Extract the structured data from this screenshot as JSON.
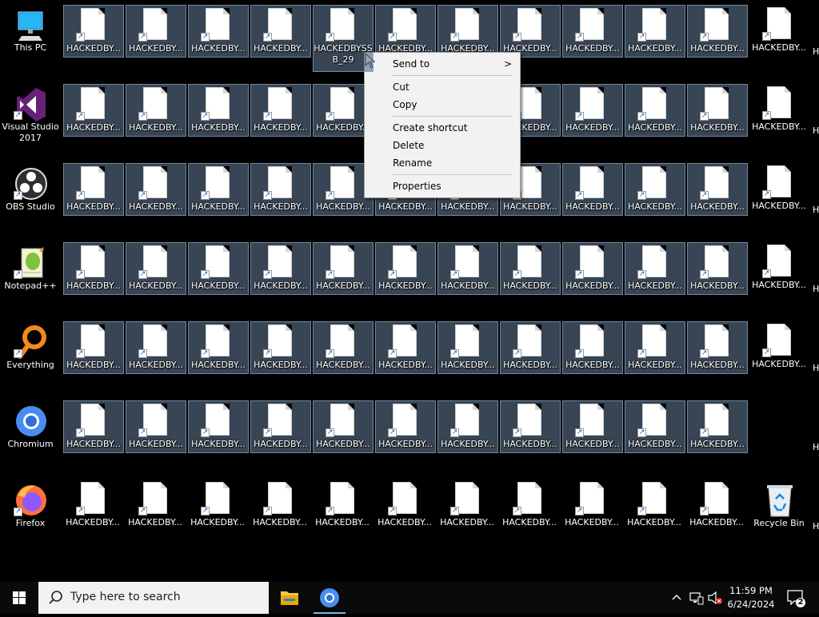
{
  "desktop": {
    "system_icons": [
      {
        "name": "this-pc",
        "label": "This PC"
      },
      {
        "name": "visual-studio",
        "label": "Visual Studio 2017"
      },
      {
        "name": "obs-studio",
        "label": "OBS Studio"
      },
      {
        "name": "notepadpp",
        "label": "Notepad++"
      },
      {
        "name": "everything",
        "label": "Everything"
      },
      {
        "name": "chromium",
        "label": "Chromium"
      },
      {
        "name": "firefox",
        "label": "Firefox"
      }
    ],
    "file_label": "HACKEDBY...",
    "focused_file_label_line1": "HACKEDBYSS",
    "focused_file_label_line2": "B_29",
    "recycle_bin_label": "Recycle Bin",
    "partial_label": "H"
  },
  "context_menu": {
    "send_to": "Send to",
    "send_to_arrow": ">",
    "cut": "Cut",
    "copy": "Copy",
    "create_shortcut": "Create shortcut",
    "delete": "Delete",
    "rename": "Rename",
    "properties": "Properties"
  },
  "taskbar": {
    "search_placeholder": "Type here to search",
    "clock_time": "11:59 PM",
    "clock_date": "6/24/2024",
    "notification_count": "2",
    "colors": {
      "taskbar_bg": "#0a0a0a",
      "search_bg": "#f2f2f2",
      "accent": "#0078d7"
    }
  }
}
